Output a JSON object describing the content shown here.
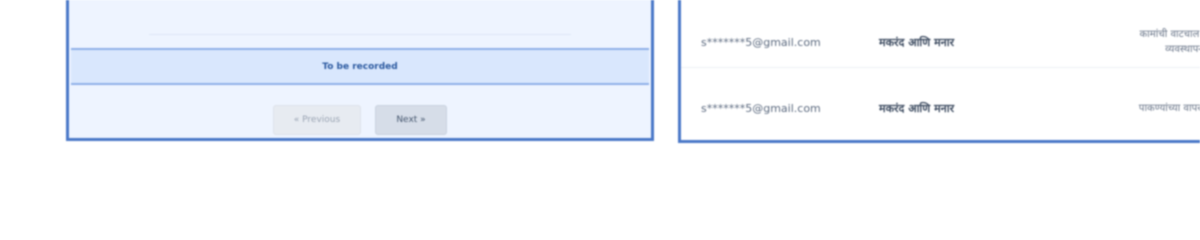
{
  "left_panel": {
    "status_text": "To be recorded",
    "pager": {
      "previous_label": "« Previous",
      "next_label": "Next »"
    }
  },
  "right_panel": {
    "rows": [
      {
        "email": "s*******5@gmail.com",
        "location": "मकरंद आणि मनार",
        "comment_lines": [
          "कामांची वाटचाल बंद काम",
          "व्यवस्थापन कार्य सु"
        ]
      },
      {
        "email": "s*******5@gmail.com",
        "location": "मकरंद आणि मनार",
        "comment_lines": [
          "पाकण्यांच्या वापरावर काम"
        ]
      }
    ]
  }
}
